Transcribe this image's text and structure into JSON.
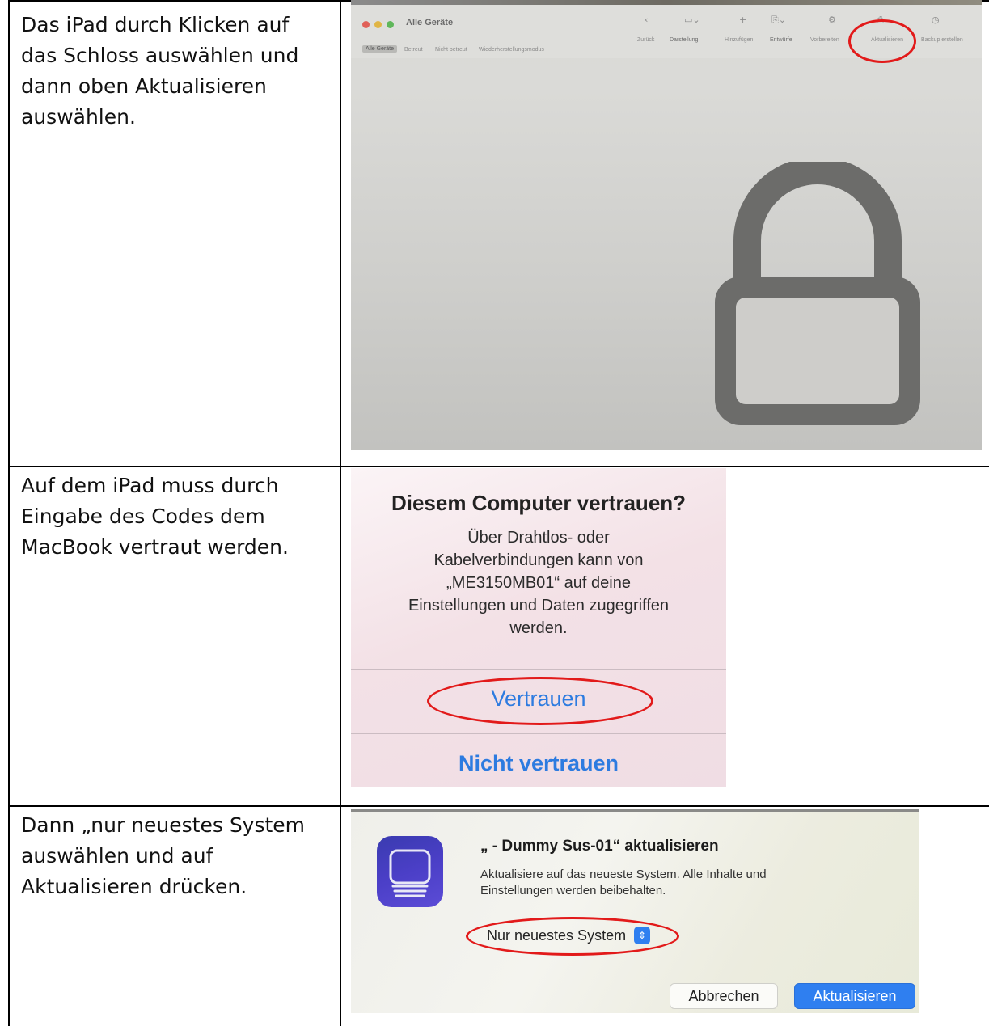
{
  "rows": [
    {
      "instruction": "Das iPad durch Klicken auf das Schloss auswählen und dann oben Aktualisieren auswählen."
    },
    {
      "instruction": "Auf dem iPad muss durch Eingabe des Codes dem MacBook vertraut werden."
    },
    {
      "instruction": "Dann „nur neuestes System auswählen und auf Aktualisieren drücken."
    }
  ],
  "configurator": {
    "window_title": "Alle Geräte",
    "toolbar": [
      "Zurück",
      "Darstellung",
      "Hinzufügen",
      "Entwürfe",
      "Vorbereiten",
      "Aktualisieren",
      "Backup erstellen"
    ],
    "segments": [
      "Alle Geräte",
      "Betreut",
      "Nicht betreut",
      "Wiederherstellungsmodus"
    ],
    "device_icon": "lock-icon",
    "highlight_color": "#e21a1a"
  },
  "trust_dialog": {
    "title": "Diesem Computer vertrauen?",
    "body_lines": [
      "Über Drahtlos- oder",
      "Kabelverbindungen kann von",
      "„ME3150MB01“ auf deine",
      "Einstellungen und Daten zugegriffen",
      "werden."
    ],
    "trust_button": "Vertrauen",
    "distrust_button": "Nicht vertrauen",
    "button_color": "#2d7be0"
  },
  "update_dialog": {
    "title": "„ - Dummy Sus-01“ aktualisieren",
    "body_lines": [
      "Aktualisiere auf das neueste System. Alle Inhalte und",
      "Einstellungen werden beibehalten."
    ],
    "select_value": "Nur neuestes System",
    "cancel_button": "Abbrechen",
    "confirm_button": "Aktualisieren",
    "app_icon": "apple-configurator-icon",
    "accent_color": "#2f7ff0"
  }
}
